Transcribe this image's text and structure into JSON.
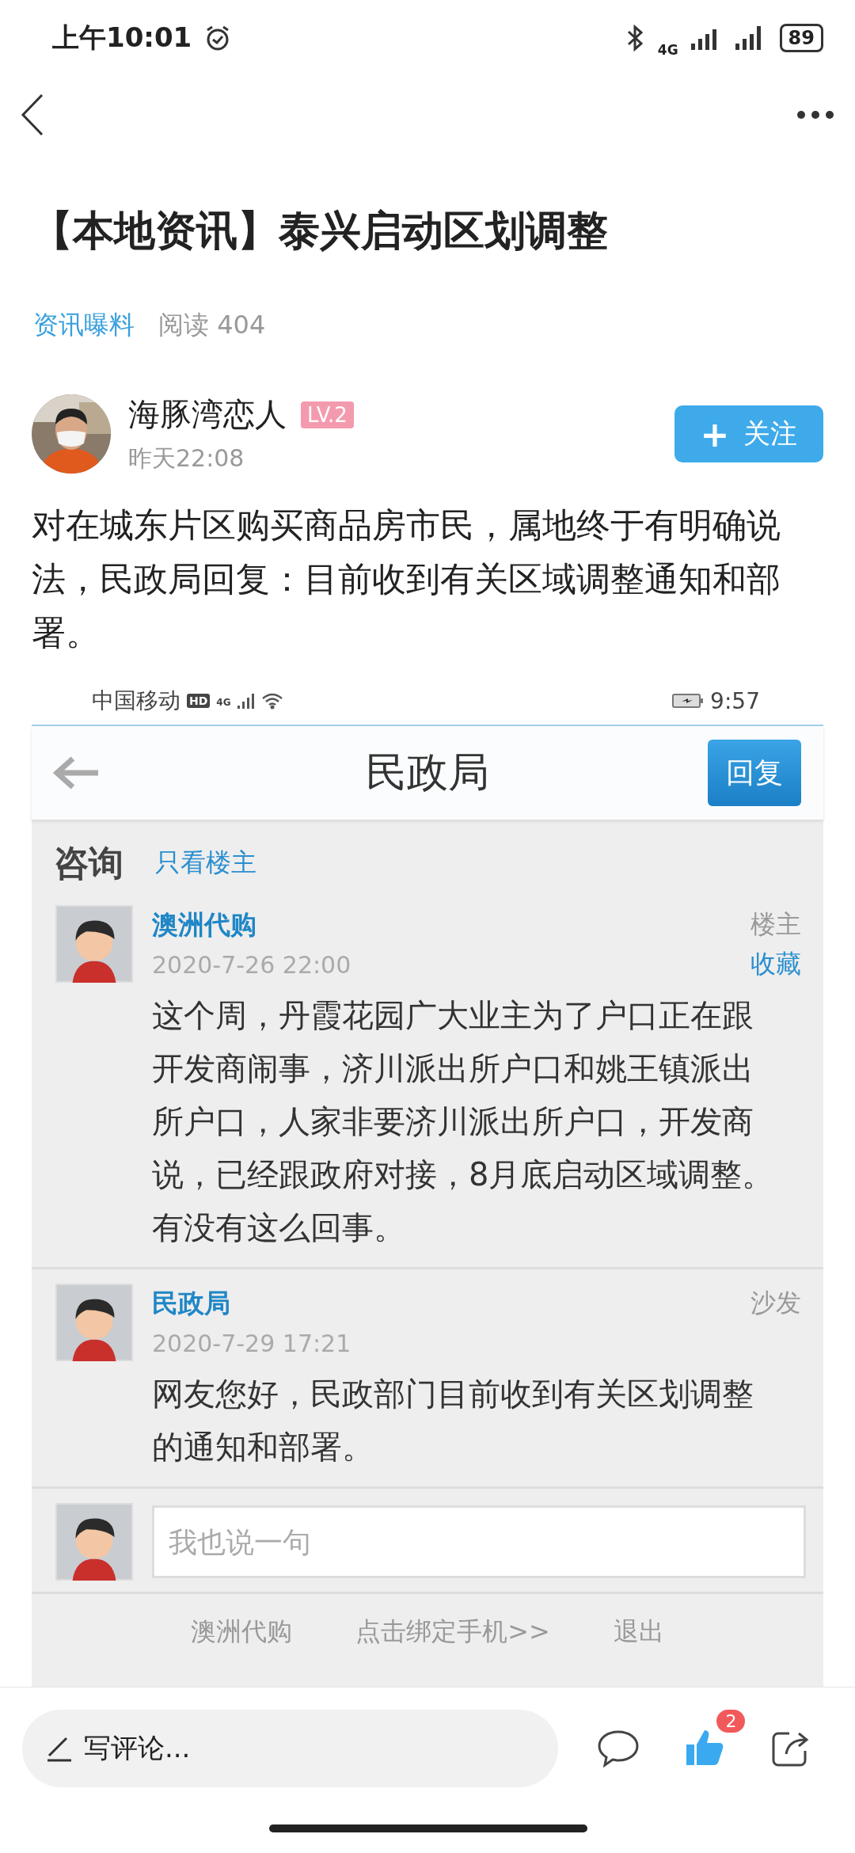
{
  "status_bar": {
    "time": "上午10:01",
    "network": "4G",
    "battery": "89"
  },
  "article": {
    "title": "【本地资讯】泰兴启动区划调整",
    "category": "资讯曝料",
    "reads": "阅读 404",
    "author": {
      "name": "海豚湾恋人",
      "level": "LV.2",
      "time": "昨天22:08"
    },
    "follow_button": {
      "icon": "+",
      "label": "关注"
    },
    "body": "对在城东片区购买商品房市民，属地终于有明确说法，民政局回复：目前收到有关区域调整通知和部署。"
  },
  "screenshot": {
    "status_bar": {
      "carrier": "中国移动",
      "hd": "HD",
      "network": "4G",
      "time": "9:57"
    },
    "title": "民政局",
    "reply_button": "回复",
    "section": "咨询",
    "filter_link": "只看楼主",
    "posts": [
      {
        "author": "澳洲代购",
        "date": "2020-7-26 22:00",
        "tag": "楼主",
        "action": "收藏",
        "text": "这个周，丹霞花园广大业主为了户口正在跟开发商闹事，济川派出所户口和姚王镇派出所户口，人家非要济川派出所户口，开发商说，已经跟政府对接，8月底启动区域调整。有没有这么回事。"
      },
      {
        "author": "民政局",
        "date": "2020-7-29 17:21",
        "tag": "沙发",
        "text": "网友您好，民政部门目前收到有关区划调整的通知和部署。"
      }
    ],
    "reply_placeholder": "我也说一句",
    "footer_links": [
      "澳洲代购",
      "点击绑定手机>>",
      "退出"
    ]
  },
  "bottom_bar": {
    "comment_placeholder": "写评论...",
    "likes": "2"
  }
}
